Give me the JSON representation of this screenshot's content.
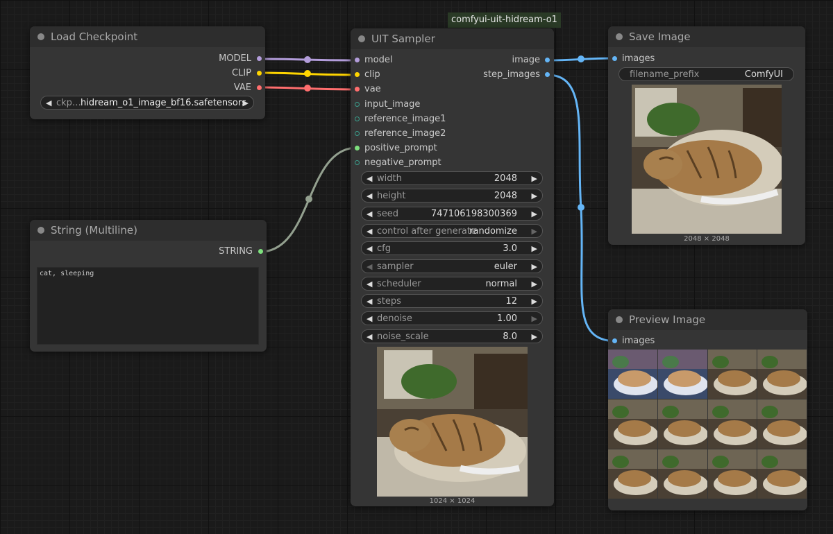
{
  "group": {
    "label": "comfyui-uit-hidream-o1"
  },
  "load_checkpoint": {
    "title": "Load Checkpoint",
    "outputs": [
      {
        "label": "MODEL",
        "color": "#b39ddb"
      },
      {
        "label": "CLIP",
        "color": "#ffd500"
      },
      {
        "label": "VAE",
        "color": "#ff6e6e"
      }
    ],
    "ckpt": {
      "label": "ckp…",
      "value": "hidream_o1_image_bf16.safetensors"
    }
  },
  "string_node": {
    "title": "String (Multiline)",
    "output": {
      "label": "STRING",
      "color": "#7ee07e"
    },
    "text": "cat, sleeping"
  },
  "sampler": {
    "title": "UIT Sampler",
    "inputs": [
      {
        "label": "model",
        "color": "#b39ddb"
      },
      {
        "label": "clip",
        "color": "#ffd500"
      },
      {
        "label": "vae",
        "color": "#ff6e6e"
      },
      {
        "label": "input_image",
        "color": "#3a9e8c"
      },
      {
        "label": "reference_image1",
        "color": "#3a9e8c"
      },
      {
        "label": "reference_image2",
        "color": "#3a9e8c"
      },
      {
        "label": "positive_prompt",
        "color": "#7ee07e"
      },
      {
        "label": "negative_prompt",
        "color": "#3a9e8c"
      }
    ],
    "outputs": [
      {
        "label": "image",
        "color": "#64b5f6"
      },
      {
        "label": "step_images",
        "color": "#64b5f6"
      }
    ],
    "widgets": [
      {
        "label": "width",
        "value": "2048"
      },
      {
        "label": "height",
        "value": "2048"
      },
      {
        "label": "seed",
        "value": "747106198300369"
      },
      {
        "label": "control after generate",
        "value": "randomize"
      },
      {
        "label": "cfg",
        "value": "3.0"
      },
      {
        "label": "sampler",
        "value": "euler"
      },
      {
        "label": "scheduler",
        "value": "normal"
      },
      {
        "label": "steps",
        "value": "12"
      },
      {
        "label": "denoise",
        "value": "1.00"
      },
      {
        "label": "noise_scale",
        "value": "8.0"
      }
    ],
    "preview_caption": "1024 × 1024"
  },
  "save_image": {
    "title": "Save Image",
    "input": {
      "label": "images",
      "color": "#64b5f6"
    },
    "prefix": {
      "label": "filename_prefix",
      "value": "ComfyUI"
    },
    "caption": "2048 × 2048"
  },
  "preview_image": {
    "title": "Preview Image",
    "input": {
      "label": "images",
      "color": "#64b5f6"
    },
    "grid_count": 12
  },
  "colors": {
    "model": "#b39ddb",
    "clip": "#ffd500",
    "vae": "#ff6e6e",
    "image": "#64b5f6",
    "string": "#7ee07e",
    "string_wire": "#93a08f"
  }
}
